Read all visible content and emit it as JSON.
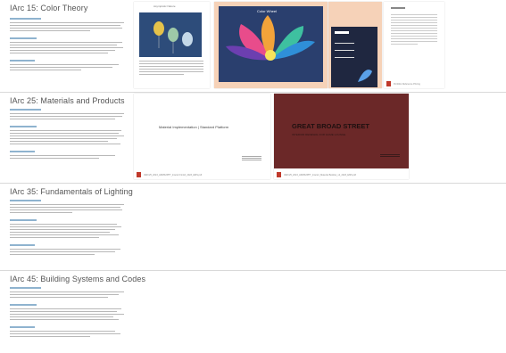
{
  "sections": [
    {
      "title": "IArc 15: Color Theory",
      "cards": [
        {
          "caption": "Asymptotic Nature",
          "file": ""
        },
        {
          "caption": "Color Wheel",
          "file": ""
        },
        {
          "caption": "",
          "file": ""
        },
        {
          "caption": "",
          "file": "Portfolio Reference Pricing"
        }
      ]
    },
    {
      "title": "IArc 25: Materials and Products",
      "cards": [
        {
          "caption": "Material Implementation | Standard Platform",
          "file": "IARC25_2023_ARMS2PPT_Interior Finish_2023_EMS.pdf"
        },
        {
          "caption": "GREAT BROAD STREET",
          "subcaption": "INTERIOR RENEWAL FOR GUME LOUNGE",
          "file": "IARC25_2023_ARMS2PPT_Interior_Material Booklet_v2_2023_EMS.pdf"
        }
      ]
    },
    {
      "title": "IArc 35: Fundamentals of Lighting"
    },
    {
      "title": "IArc 45: Building Systems and Codes"
    }
  ],
  "colors": {
    "accent_link": "#8fb3cf",
    "pdf_red": "#c0392b",
    "maroon_slide": "#6b2828",
    "peach_bg": "#f6d2b8"
  }
}
